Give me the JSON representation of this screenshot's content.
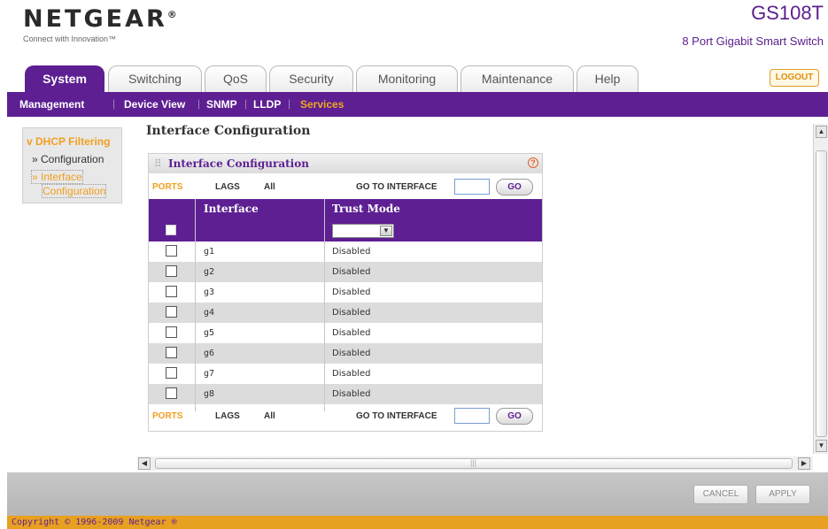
{
  "header": {
    "brand": "NETGEAR",
    "brand_mark": "®",
    "tagline": "Connect with Innovation™",
    "model": "GS108T",
    "model_desc": "8 Port Gigabit Smart Switch"
  },
  "tabs": [
    {
      "label": "System",
      "active": true
    },
    {
      "label": "Switching",
      "active": false
    },
    {
      "label": "QoS",
      "active": false
    },
    {
      "label": "Security",
      "active": false
    },
    {
      "label": "Monitoring",
      "active": false
    },
    {
      "label": "Maintenance",
      "active": false
    },
    {
      "label": "Help",
      "active": false
    }
  ],
  "logout_label": "LOGOUT",
  "subnav": [
    {
      "label": "Management",
      "active": false
    },
    {
      "label": "Device View",
      "active": false
    },
    {
      "label": "SNMP",
      "active": false
    },
    {
      "label": "LLDP",
      "active": false
    },
    {
      "label": "Services",
      "active": true
    }
  ],
  "sidebar": {
    "title": "DHCP Filtering",
    "title_icon": "chevron-down-icon",
    "items": [
      {
        "label": "Configuration",
        "active": false
      },
      {
        "label": "Interface",
        "active": true
      },
      {
        "label": "Configuration",
        "active": true
      }
    ]
  },
  "page_title": "Interface Configuration",
  "panel": {
    "title": "Interface Configuration",
    "help_icon": "?",
    "filter": {
      "ports": "PORTS",
      "lags": "LAGS",
      "all": "All",
      "goto": "GO TO INTERFACE",
      "go": "GO",
      "goto_value": ""
    },
    "columns": [
      "Interface",
      "Trust Mode"
    ],
    "set_all_mode": "",
    "rows": [
      {
        "interface": "g1",
        "mode": "Disabled"
      },
      {
        "interface": "g2",
        "mode": "Disabled"
      },
      {
        "interface": "g3",
        "mode": "Disabled"
      },
      {
        "interface": "g4",
        "mode": "Disabled"
      },
      {
        "interface": "g5",
        "mode": "Disabled"
      },
      {
        "interface": "g6",
        "mode": "Disabled"
      },
      {
        "interface": "g7",
        "mode": "Disabled"
      },
      {
        "interface": "g8",
        "mode": "Disabled"
      }
    ]
  },
  "actions": {
    "cancel": "CANCEL",
    "apply": "APPLY"
  },
  "copyright": "Copyright © 1996-2009 Netgear ®",
  "colors": {
    "purple": "#5d1f92",
    "orange": "#f0a020"
  }
}
